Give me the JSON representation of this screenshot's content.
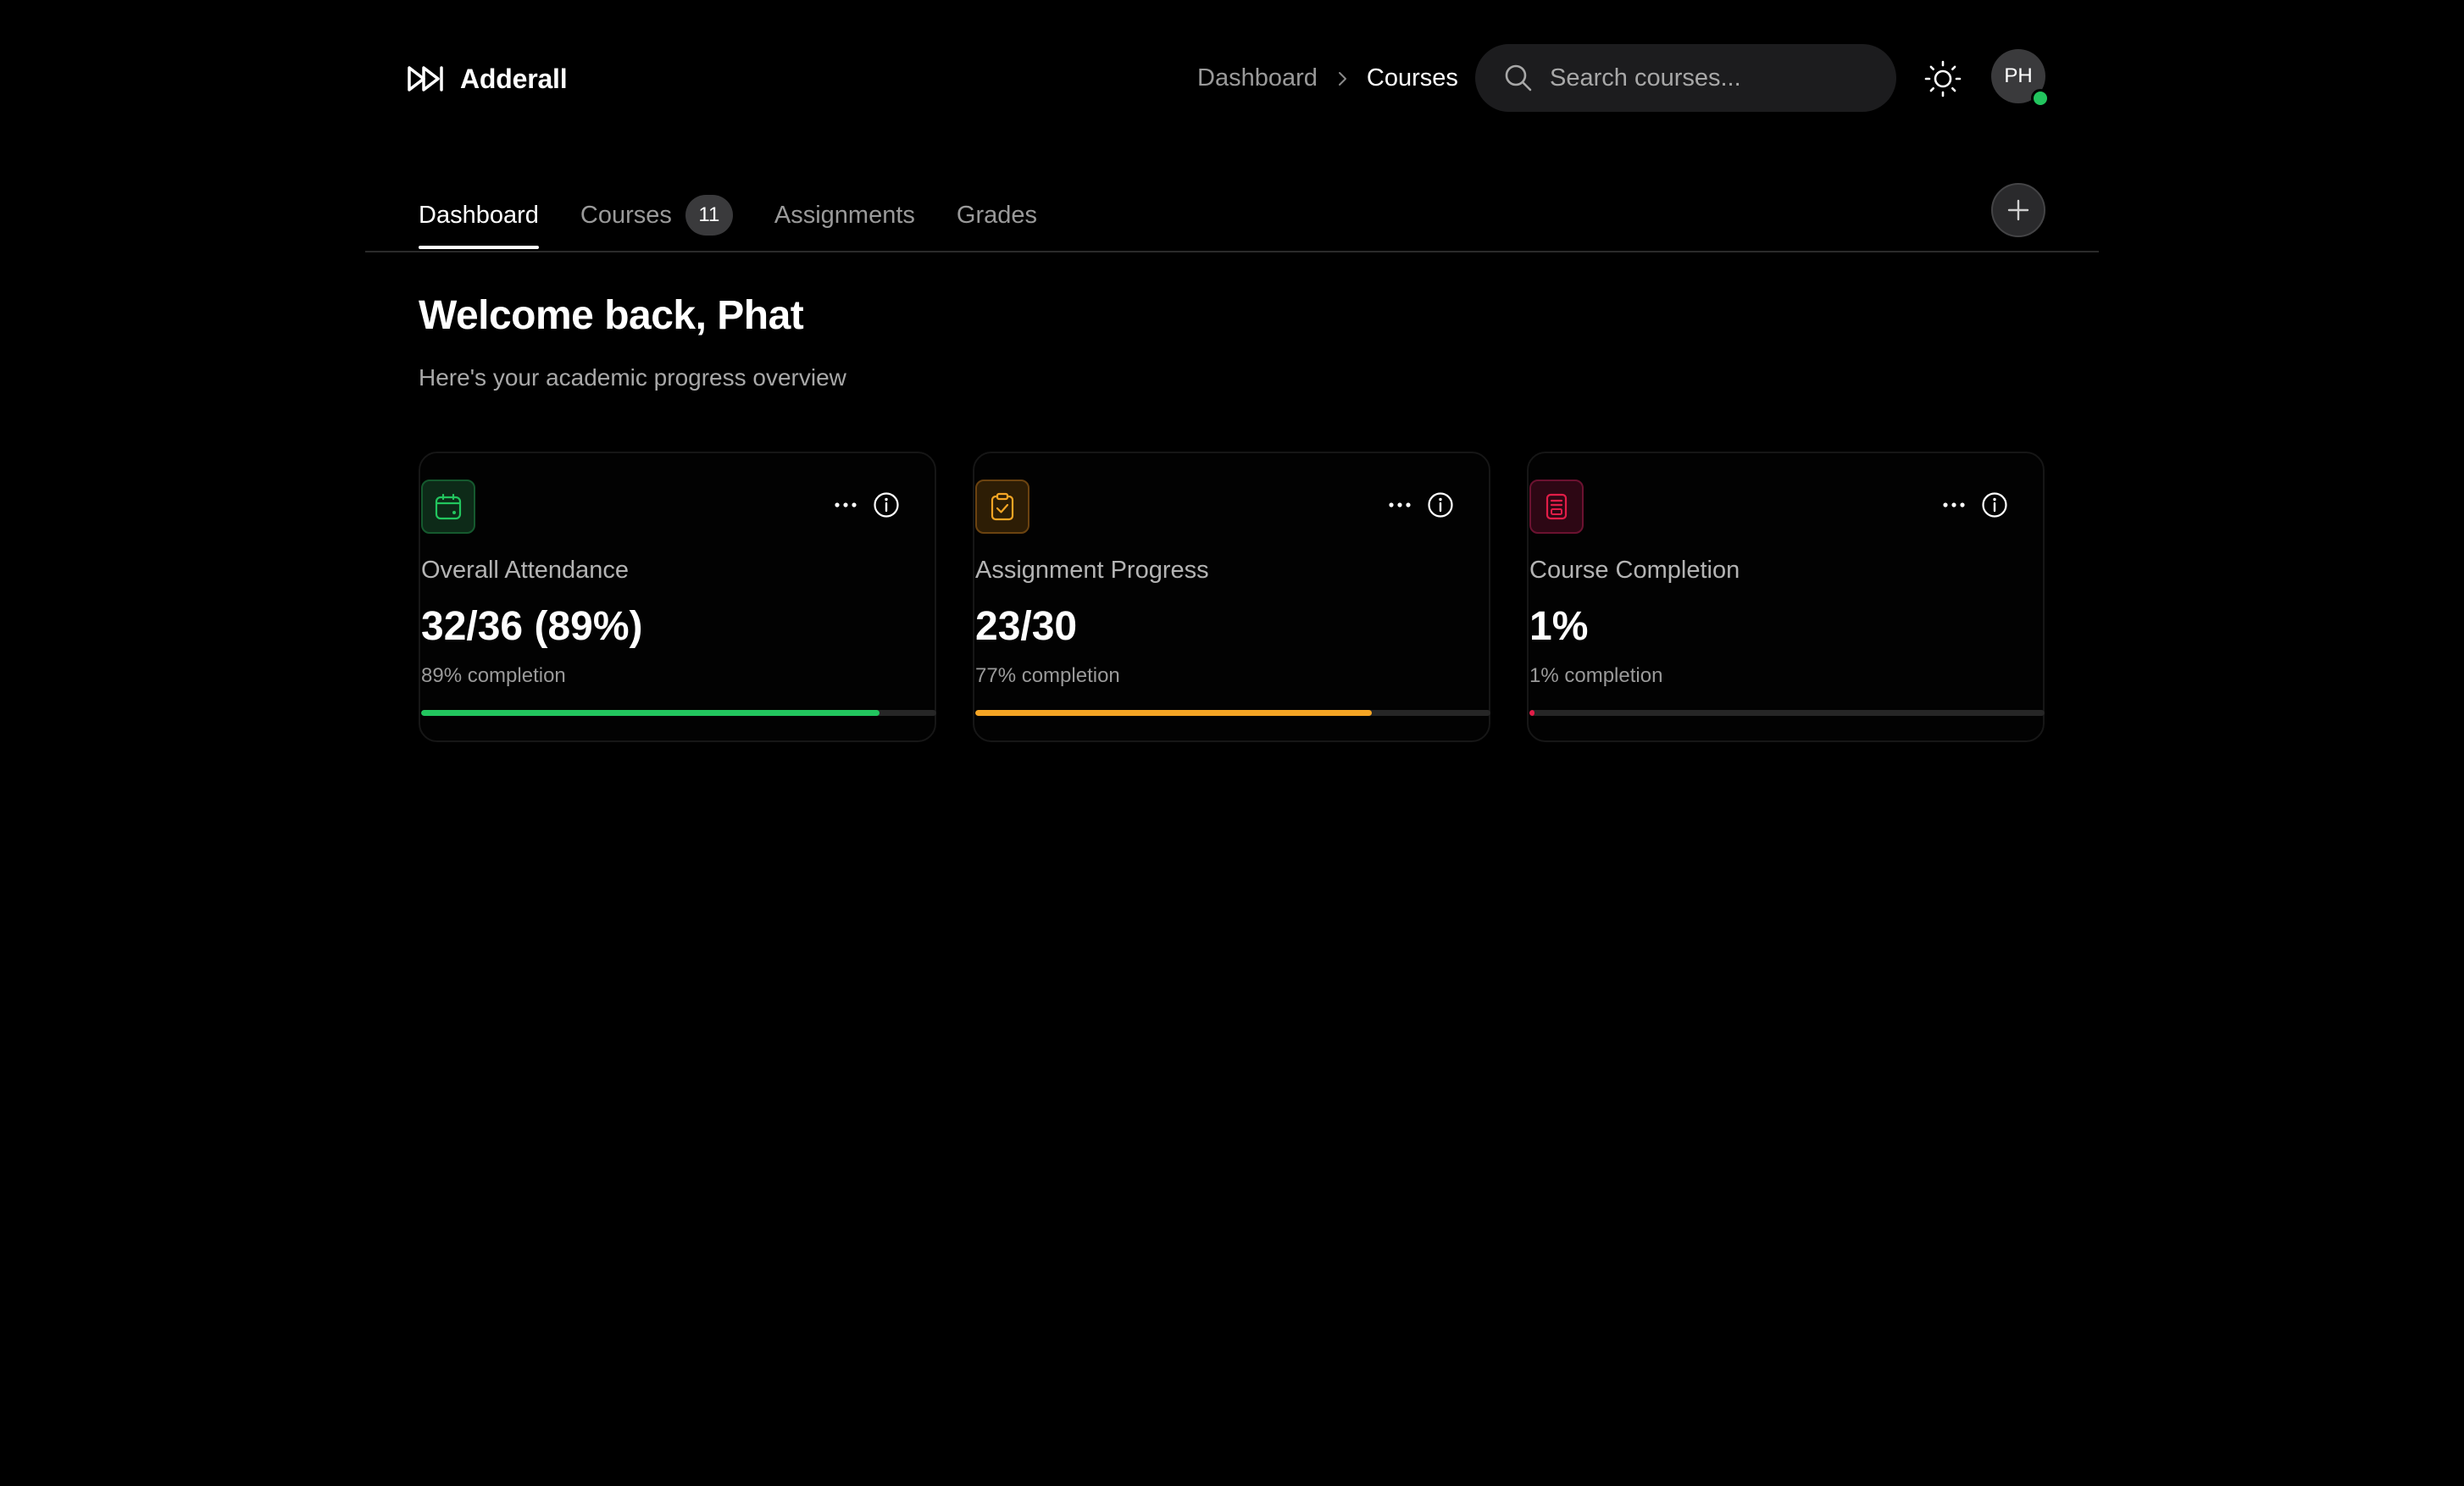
{
  "app": {
    "name": "Adderall"
  },
  "breadcrumb": {
    "items": [
      "Dashboard",
      "Courses"
    ]
  },
  "search": {
    "placeholder": "Search courses..."
  },
  "user": {
    "initials": "PH",
    "online": true
  },
  "tabs": [
    {
      "label": "Dashboard",
      "active": true
    },
    {
      "label": "Courses",
      "badge": "11",
      "active": false
    },
    {
      "label": "Assignments",
      "active": false
    },
    {
      "label": "Grades",
      "active": false
    }
  ],
  "welcome": {
    "title": "Welcome back, Phat",
    "subtitle": "Here's your academic progress overview"
  },
  "cards": [
    {
      "label": "Overall Attendance",
      "value": "32/36 (89%)",
      "caption": "89% completion",
      "progress": 0.89,
      "accent": "#22c55e",
      "icon_bg": "#0d2a18",
      "icon_border": "#15592e",
      "icon": "calendar-icon"
    },
    {
      "label": "Assignment Progress",
      "value": "23/30",
      "caption": "77% completion",
      "progress": 0.77,
      "accent": "#f5a524",
      "icon_bg": "#2d1d05",
      "icon_border": "#6b4310",
      "icon": "clipboard-check-icon"
    },
    {
      "label": "Course Completion",
      "value": "1%",
      "caption": "1% completion",
      "progress": 0.01,
      "accent": "#e11d48",
      "icon_bg": "#2d0714",
      "icon_border": "#6b1230",
      "icon": "book-icon"
    }
  ],
  "colors": {
    "background": "#000000",
    "surface": "#1c1c1e",
    "text_primary": "#ffffff",
    "text_secondary": "#9a9a9a",
    "online": "#22c55e"
  }
}
